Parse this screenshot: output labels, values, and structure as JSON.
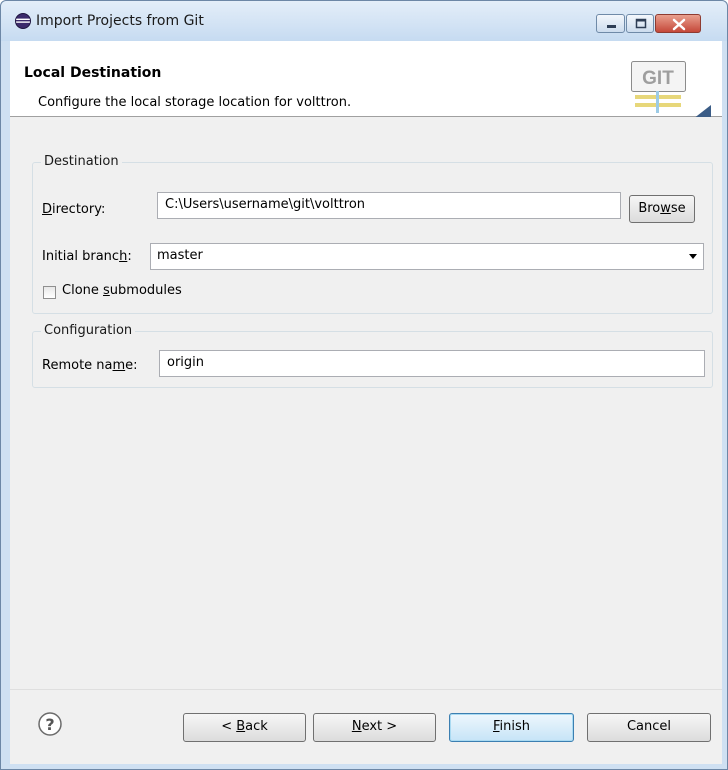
{
  "window": {
    "title": "Import Projects from Git"
  },
  "header": {
    "title": "Local Destination",
    "description": "Configure the local storage location for volttron.",
    "logo_text": "GIT"
  },
  "destination": {
    "legend": "Destination",
    "directory_label_prefix": "D",
    "directory_label_rest": "irectory:",
    "directory_value": "C:\\Users\\username\\git\\volttron",
    "browse_label_prefix": "Bro",
    "browse_label_underlined": "w",
    "browse_label_rest": "se",
    "initial_branch_label_prefix": "Initial branc",
    "initial_branch_label_underlined": "h",
    "initial_branch_label_rest": ":",
    "initial_branch_value": "master",
    "clone_submodules_prefix": "Clone ",
    "clone_submodules_underlined": "s",
    "clone_submodules_rest": "ubmodules",
    "clone_submodules_checked": false
  },
  "configuration": {
    "legend": "Configuration",
    "remote_name_label_prefix": "Remote na",
    "remote_name_label_underlined": "m",
    "remote_name_label_rest": "e:",
    "remote_name_value": "origin"
  },
  "footer": {
    "back_prefix": "< ",
    "back_underlined": "B",
    "back_rest": "ack",
    "next_underlined": "N",
    "next_rest": "ext >",
    "finish_underlined": "F",
    "finish_rest": "inish",
    "cancel_label": "Cancel"
  }
}
